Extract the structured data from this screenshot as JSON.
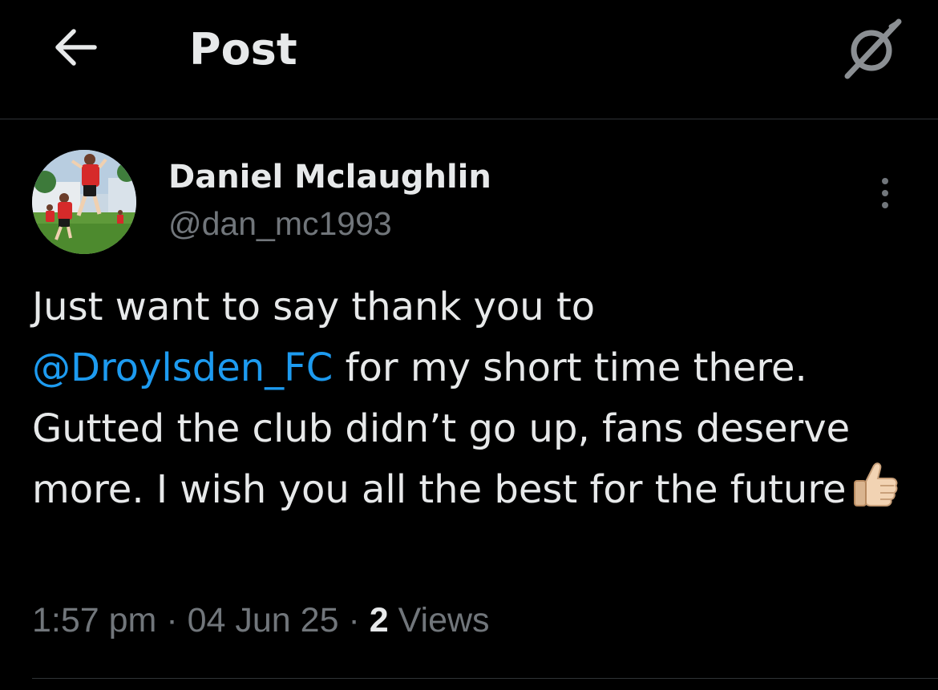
{
  "header": {
    "title": "Post",
    "back_icon": "arrow-left-icon",
    "grok_icon": "grok-icon"
  },
  "post": {
    "author": {
      "name": "Daniel Mclaughlin",
      "handle": "@dan_mc1993",
      "avatar": "avatar-photo"
    },
    "more_icon": "more-vertical-icon",
    "text": {
      "line1": "Just want to say thank you to",
      "mention": "@Droylsden_FC",
      "after_mention": " for my short time there.",
      "rest": "Gutted the club didn’t go up, fans deserve more. I wish you all the best for the future",
      "emoji": "thumbs-up-emoji"
    },
    "meta": {
      "time": "1:57 pm",
      "separator": "·",
      "date": "04 Jun 25",
      "views_count": "2",
      "views_label": "Views"
    }
  },
  "colors": {
    "background": "#000000",
    "primary_text": "#e7e9ea",
    "secondary_text": "#71767b",
    "mention": "#1d9bf0",
    "divider": "#2f3336"
  }
}
